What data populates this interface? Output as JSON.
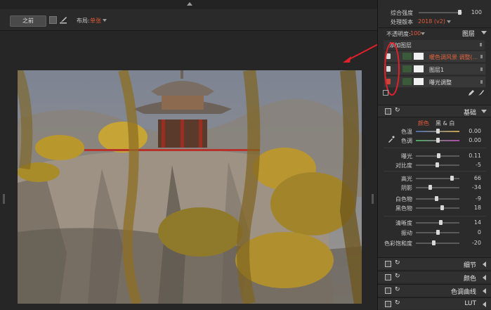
{
  "toolbar": {
    "before_button": "之前",
    "layout_label": "布局:",
    "layout_value": "单张"
  },
  "panel": {
    "top": {
      "intensity_label": "综合强度",
      "intensity_value": "100",
      "process_label": "处理版本",
      "process_value": "2018 (v2)"
    },
    "layers": {
      "opacity_label": "不透明度:",
      "opacity_value": "100",
      "title": "图层",
      "add_label": "添加图层",
      "items": [
        {
          "name": "暖色调风景 调整(...",
          "color": "#e0633c"
        },
        {
          "name": "图层1",
          "color": "#dcdcdc"
        },
        {
          "name": "曝光调整",
          "color": "#dcdcdc"
        }
      ]
    },
    "basic": {
      "title": "基础",
      "mode_color": "颜色",
      "mode_bw": "黑 & 白",
      "sliders": [
        {
          "label": "色温",
          "value": "0.00",
          "level": 0.5
        },
        {
          "label": "色调",
          "value": "0.00",
          "level": 0.5
        },
        {
          "label": "曝光",
          "value": "0.11",
          "level": 0.51
        },
        {
          "label": "对比度",
          "value": "-5",
          "level": 0.48
        },
        {
          "label": "高光",
          "value": "66",
          "level": 0.83
        },
        {
          "label": "阴影",
          "value": "-34",
          "level": 0.33
        },
        {
          "label": "白色物",
          "value": "-9",
          "level": 0.46
        },
        {
          "label": "黑色物",
          "value": "18",
          "level": 0.59
        },
        {
          "label": "清晰度",
          "value": "14",
          "level": 0.57
        },
        {
          "label": "振动",
          "value": "0",
          "level": 0.5
        },
        {
          "label": "色彩饱和度",
          "value": "-20",
          "level": 0.4
        }
      ]
    },
    "sections": [
      "细节",
      "颜色",
      "色调曲线",
      "LUT"
    ]
  },
  "colors": {
    "accent": "#e35a3a",
    "annotation": "#e0202a"
  }
}
